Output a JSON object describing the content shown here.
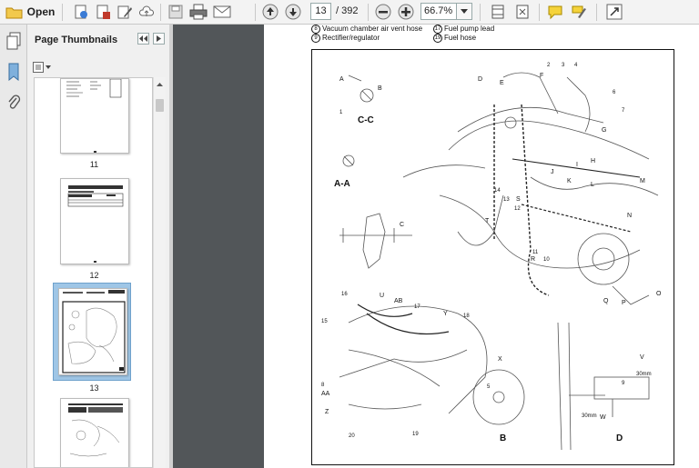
{
  "toolbar": {
    "open_label": "Open",
    "current_page": "13",
    "total_pages": "/ 392",
    "zoom": "66.7%"
  },
  "panel": {
    "title": "Page Thumbnails",
    "thumbnails": [
      {
        "label": "11",
        "selected": false
      },
      {
        "label": "12",
        "selected": false
      },
      {
        "label": "13",
        "selected": true
      },
      {
        "label": "",
        "selected": false
      }
    ]
  },
  "document": {
    "legend": [
      {
        "num": "8",
        "text": "Vacuum chamber air vent hose"
      },
      {
        "num": "17",
        "text": "Fuel pump lead"
      },
      {
        "num": "9",
        "text": "Rectifier/regulator"
      },
      {
        "num": "19",
        "text": "Fuel hose"
      }
    ],
    "section_labels": [
      "C-C",
      "A-A",
      "B",
      "D"
    ],
    "callouts": [
      "A",
      "B",
      "C",
      "D",
      "E",
      "F",
      "G",
      "H",
      "I",
      "J",
      "K",
      "L",
      "M",
      "N",
      "O",
      "P",
      "Q",
      "R",
      "S",
      "T",
      "U",
      "V",
      "W",
      "X",
      "Y",
      "Z",
      "AA",
      "AB"
    ],
    "numbers": [
      "1",
      "2",
      "3",
      "4",
      "5",
      "6",
      "7",
      "8",
      "9",
      "10",
      "11",
      "12",
      "13",
      "14",
      "15",
      "16",
      "17",
      "18",
      "19",
      "20"
    ],
    "dimension_labels": [
      "30mm",
      "30mm"
    ]
  },
  "colors": {
    "toolbar_bg": "#f3f3f3",
    "viewer_bg": "#525659",
    "selected_thumb": "#9fc6e6",
    "panel_bg": "#f0f0f0"
  }
}
